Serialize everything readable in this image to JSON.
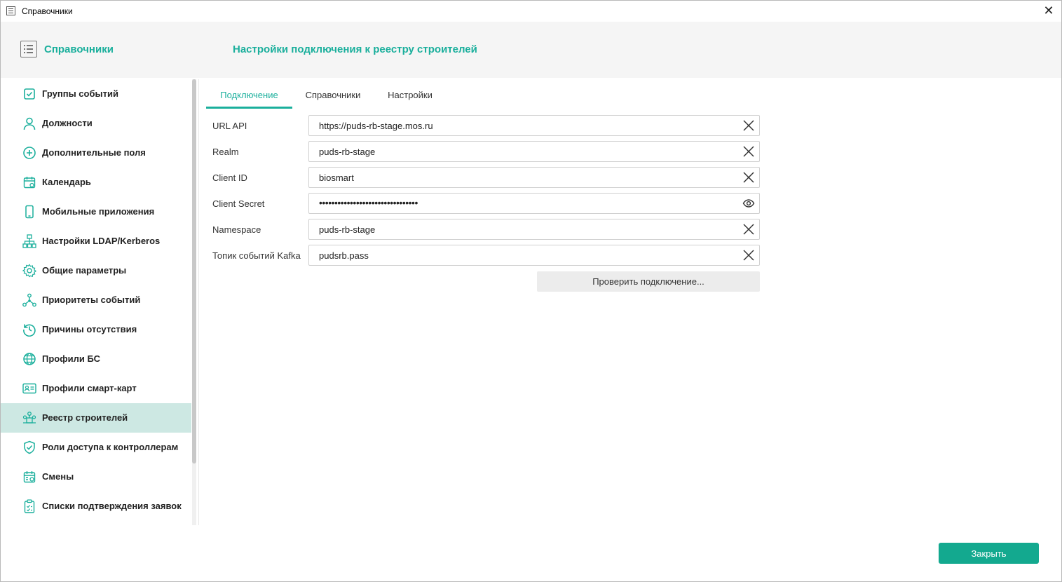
{
  "window": {
    "title": "Справочники",
    "close_glyph": "✕"
  },
  "header": {
    "app_title": "Справочники",
    "page_title": "Настройки подключения к реестру строителей"
  },
  "sidebar": {
    "items": [
      {
        "label": "Группы событий",
        "icon": "checkbox-icon"
      },
      {
        "label": "Должности",
        "icon": "person-icon"
      },
      {
        "label": "Дополнительные поля",
        "icon": "plus-circle-icon"
      },
      {
        "label": "Календарь",
        "icon": "calendar-icon"
      },
      {
        "label": "Мобильные приложения",
        "icon": "mobile-icon"
      },
      {
        "label": "Настройки LDAP/Kerberos",
        "icon": "network-icon"
      },
      {
        "label": "Общие параметры",
        "icon": "gear-icon"
      },
      {
        "label": "Приоритеты событий",
        "icon": "nodes-icon"
      },
      {
        "label": "Причины отсутствия",
        "icon": "history-icon"
      },
      {
        "label": "Профили БС",
        "icon": "globe-icon"
      },
      {
        "label": "Профили смарт-карт",
        "icon": "id-card-icon"
      },
      {
        "label": "Реестр строителей",
        "icon": "builders-registry-icon",
        "active": true
      },
      {
        "label": "Роли доступа к контроллерам",
        "icon": "shield-icon"
      },
      {
        "label": "Смены",
        "icon": "schedule-icon"
      },
      {
        "label": "Списки подтверждения заявок",
        "icon": "clipboard-icon"
      }
    ]
  },
  "tabs": [
    {
      "label": "Подключение",
      "active": true
    },
    {
      "label": "Справочники"
    },
    {
      "label": "Настройки"
    }
  ],
  "form": {
    "fields": [
      {
        "label": "URL API",
        "value": "https://puds-rb-stage.mos.ru",
        "action": "clear-icon"
      },
      {
        "label": "Realm",
        "value": "puds-rb-stage",
        "action": "clear-icon"
      },
      {
        "label": "Client ID",
        "value": "biosmart",
        "action": "clear-icon"
      },
      {
        "label": "Client Secret",
        "value": "••••••••••••••••••••••••••••••••",
        "action": "eye-icon"
      },
      {
        "label": "Namespace",
        "value": "puds-rb-stage",
        "action": "clear-icon"
      },
      {
        "label": "Топик событий Kafka",
        "value": "pudsrb.pass",
        "action": "clear-icon"
      }
    ],
    "check_button": "Проверить подключение..."
  },
  "footer": {
    "close_button": "Закрыть"
  },
  "colors": {
    "accent": "#1aaf9c",
    "active_bg": "#cde8e3",
    "button": "#13a98f"
  }
}
